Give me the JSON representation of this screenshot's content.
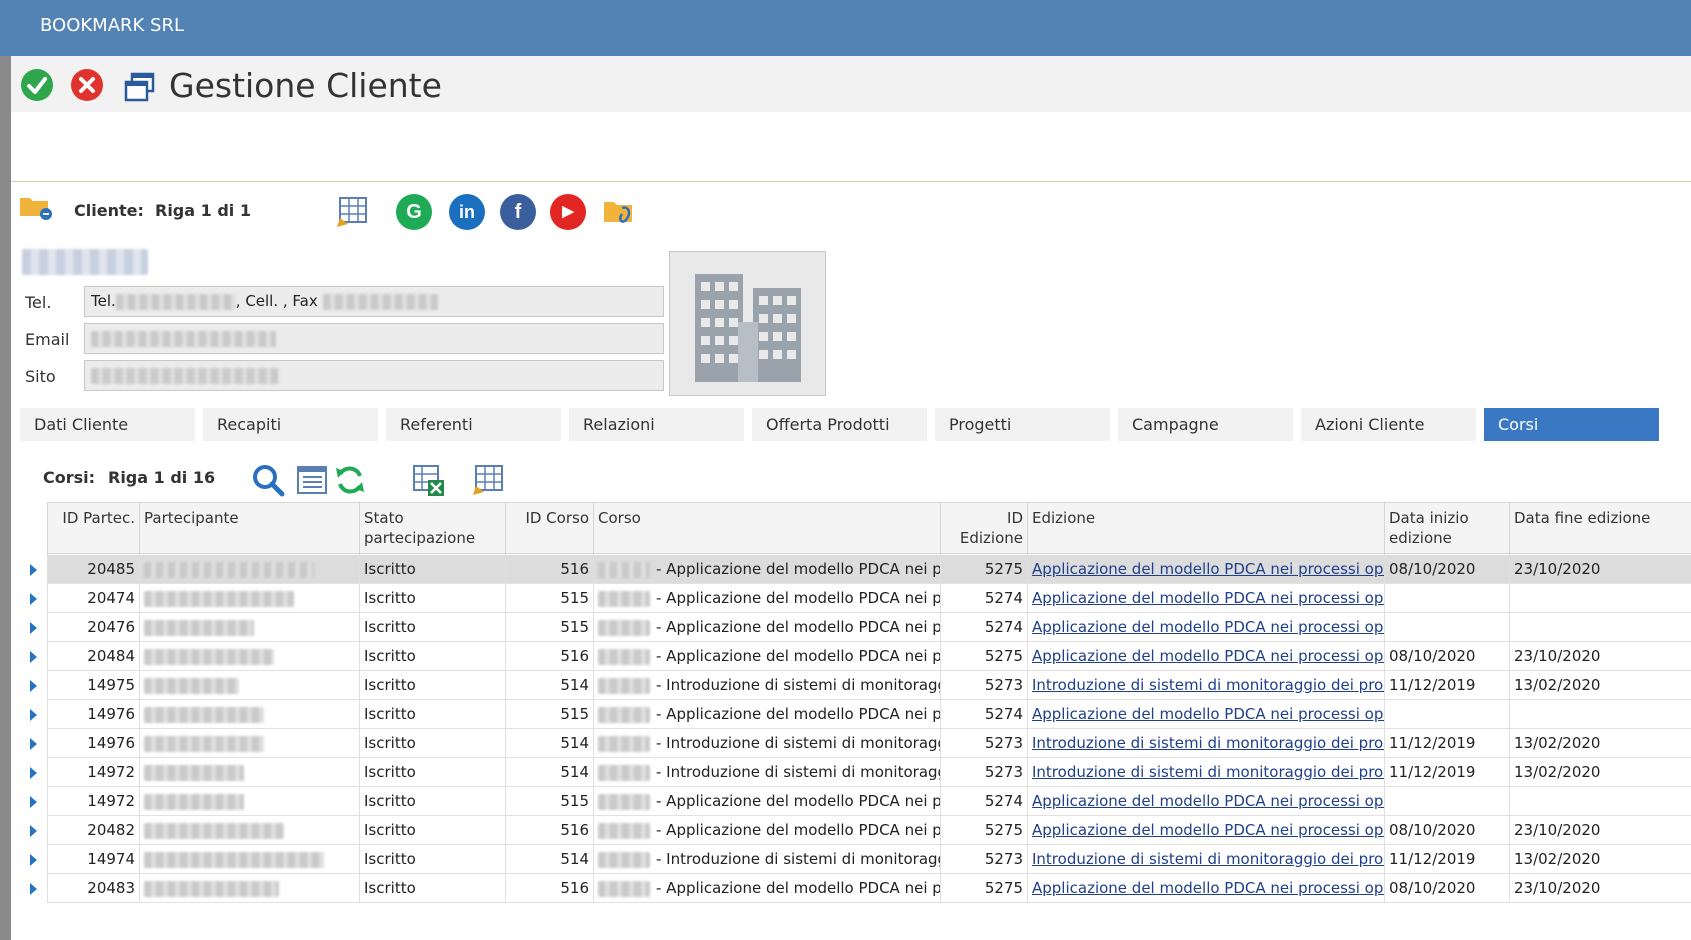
{
  "app": {
    "title": "BOOKMARK SRL"
  },
  "header": {
    "page_title": "Gestione Cliente",
    "icons": [
      "check-circle-icon",
      "close-circle-icon",
      "window-icon"
    ]
  },
  "client": {
    "label": "Cliente:",
    "record_info": "Riga 1 di 1",
    "fields": {
      "tel_label": "Tel.",
      "tel_prefix": "Tel.",
      "tel_cell": ", Cell. , Fax",
      "email_label": "Email",
      "site_label": "Sito"
    },
    "social_icons": [
      "google-icon",
      "linkedin-icon",
      "facebook-icon",
      "youtube-icon"
    ],
    "social_glyphs": {
      "google": "G",
      "linkedin": "in",
      "facebook": "f",
      "youtube": "▶"
    }
  },
  "tabs": [
    {
      "label": "Dati Cliente",
      "active": false
    },
    {
      "label": "Recapiti",
      "active": false
    },
    {
      "label": "Referenti",
      "active": false
    },
    {
      "label": "Relazioni",
      "active": false
    },
    {
      "label": "Offerta Prodotti",
      "active": false
    },
    {
      "label": "Progetti",
      "active": false
    },
    {
      "label": "Campagne",
      "active": false
    },
    {
      "label": "Azioni Cliente",
      "active": false
    },
    {
      "label": "Corsi",
      "active": true
    }
  ],
  "corsi": {
    "label": "Corsi:",
    "record_info": "Riga 1 di 16",
    "columns": [
      "ID Partec.",
      "Partecipante",
      "Stato partecipazione",
      "ID Corso",
      "Corso",
      "ID Edizione",
      "Edizione",
      "Data inizio edizione",
      "Data fine edizione"
    ],
    "rows": [
      {
        "id_partec": "20485",
        "stato": "Iscritto",
        "id_corso": "516",
        "corso": "- Applicazione del modello PDCA nei proce",
        "id_edizione": "5275",
        "edizione": "Applicazione del modello PDCA nei processi oper",
        "data_inizio": "08/10/2020",
        "data_fine": "23/10/2020"
      },
      {
        "id_partec": "20474",
        "stato": "Iscritto",
        "id_corso": "515",
        "corso": "- Applicazione del modello PDCA nei proce",
        "id_edizione": "5274",
        "edizione": "Applicazione del modello PDCA nei processi oper",
        "data_inizio": "",
        "data_fine": ""
      },
      {
        "id_partec": "20476",
        "stato": "Iscritto",
        "id_corso": "515",
        "corso": "- Applicazione del modello PDCA nei proce",
        "id_edizione": "5274",
        "edizione": "Applicazione del modello PDCA nei processi oper",
        "data_inizio": "",
        "data_fine": ""
      },
      {
        "id_partec": "20484",
        "stato": "Iscritto",
        "id_corso": "516",
        "corso": "- Applicazione del modello PDCA nei proce",
        "id_edizione": "5275",
        "edizione": "Applicazione del modello PDCA nei processi oper",
        "data_inizio": "08/10/2020",
        "data_fine": "23/10/2020"
      },
      {
        "id_partec": "14975",
        "stato": "Iscritto",
        "id_corso": "514",
        "corso": "- Introduzione di sistemi di monitoraggio",
        "id_edizione": "5273",
        "edizione": "Introduzione di sistemi di monitoraggio dei proce",
        "data_inizio": "11/12/2019",
        "data_fine": "13/02/2020"
      },
      {
        "id_partec": "14976",
        "stato": "Iscritto",
        "id_corso": "515",
        "corso": "- Applicazione del modello PDCA nei proce",
        "id_edizione": "5274",
        "edizione": "Applicazione del modello PDCA nei processi oper",
        "data_inizio": "",
        "data_fine": ""
      },
      {
        "id_partec": "14976",
        "stato": "Iscritto",
        "id_corso": "514",
        "corso": "- Introduzione di sistemi di monitoraggio",
        "id_edizione": "5273",
        "edizione": "Introduzione di sistemi di monitoraggio dei proce",
        "data_inizio": "11/12/2019",
        "data_fine": "13/02/2020"
      },
      {
        "id_partec": "14972",
        "stato": "Iscritto",
        "id_corso": "514",
        "corso": "- Introduzione di sistemi di monitoraggio",
        "id_edizione": "5273",
        "edizione": "Introduzione di sistemi di monitoraggio dei proce",
        "data_inizio": "11/12/2019",
        "data_fine": "13/02/2020"
      },
      {
        "id_partec": "14972",
        "stato": "Iscritto",
        "id_corso": "515",
        "corso": "- Applicazione del modello PDCA nei proce",
        "id_edizione": "5274",
        "edizione": "Applicazione del modello PDCA nei processi oper",
        "data_inizio": "",
        "data_fine": ""
      },
      {
        "id_partec": "20482",
        "stato": "Iscritto",
        "id_corso": "516",
        "corso": "- Applicazione del modello PDCA nei proce",
        "id_edizione": "5275",
        "edizione": "Applicazione del modello PDCA nei processi oper",
        "data_inizio": "08/10/2020",
        "data_fine": "23/10/2020"
      },
      {
        "id_partec": "14974",
        "stato": "Iscritto",
        "id_corso": "514",
        "corso": "- Introduzione di sistemi di monitoraggio",
        "id_edizione": "5273",
        "edizione": "Introduzione di sistemi di monitoraggio dei proce",
        "data_inizio": "11/12/2019",
        "data_fine": "13/02/2020"
      },
      {
        "id_partec": "20483",
        "stato": "Iscritto",
        "id_corso": "516",
        "corso": "- Applicazione del modello PDCA nei proce",
        "id_edizione": "5275",
        "edizione": "Applicazione del modello PDCA nei processi oper",
        "data_inizio": "08/10/2020",
        "data_fine": "23/10/2020"
      }
    ]
  },
  "colors": {
    "topbar": "#5383b5",
    "active_tab": "#3b78c3",
    "link": "#1f3f8a",
    "ok": "#2fa54c",
    "cancel": "#e0332d"
  }
}
